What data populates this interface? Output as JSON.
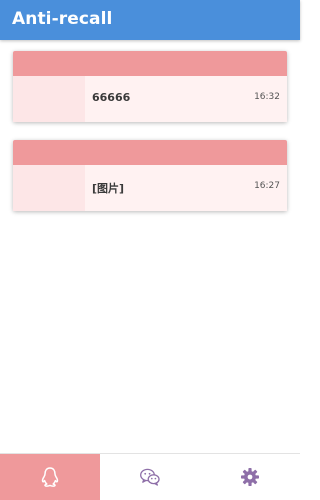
{
  "app": {
    "title": "Anti-recall"
  },
  "messages": [
    {
      "text": "66666",
      "time": "16:32"
    },
    {
      "text": "[图片]",
      "time": "16:27"
    }
  ],
  "nav": {
    "tabs": [
      {
        "icon": "qq-penguin-icon",
        "active": true
      },
      {
        "icon": "wechat-icon",
        "active": false
      },
      {
        "icon": "gear-icon",
        "active": false
      }
    ]
  },
  "colors": {
    "appbar": "#4a8fdb",
    "card_header": "#ef999b",
    "card_body": "#fff2f2",
    "nav_active": "#ef999b",
    "nav_icon": "#8e6fa8"
  }
}
